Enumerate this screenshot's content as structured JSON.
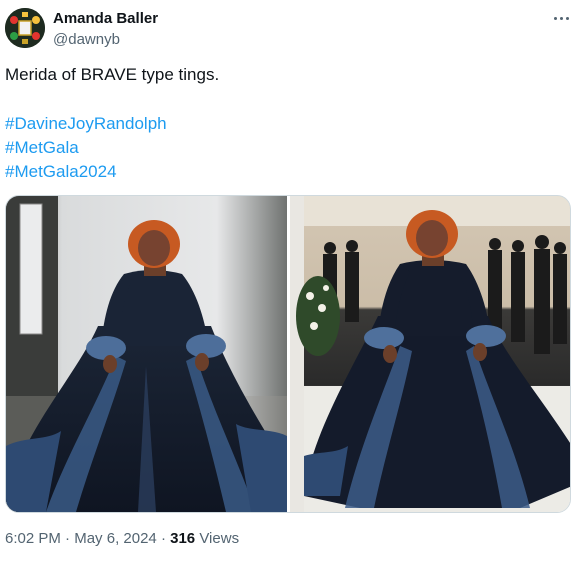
{
  "author": {
    "name": "Amanda Baller",
    "handle": "@dawnyb"
  },
  "tweet": {
    "text": "Merida of BRAVE type tings.",
    "hashtags": [
      "#DavineJoyRandolph",
      "#MetGala",
      "#MetGala2024"
    ]
  },
  "media": [
    {
      "kind": "photo",
      "subject": "studio-portrait"
    },
    {
      "kind": "photo",
      "subject": "red-carpet"
    }
  ],
  "meta": {
    "time": "6:02 PM",
    "separator": "·",
    "date": "May 6, 2024",
    "views_count": "316",
    "views_label": "Views"
  },
  "colors": {
    "link": "#1d9bf0",
    "secondary_text": "#536471",
    "primary_text": "#0f1419"
  },
  "icons": {
    "more": "more-horizontal-icon"
  }
}
